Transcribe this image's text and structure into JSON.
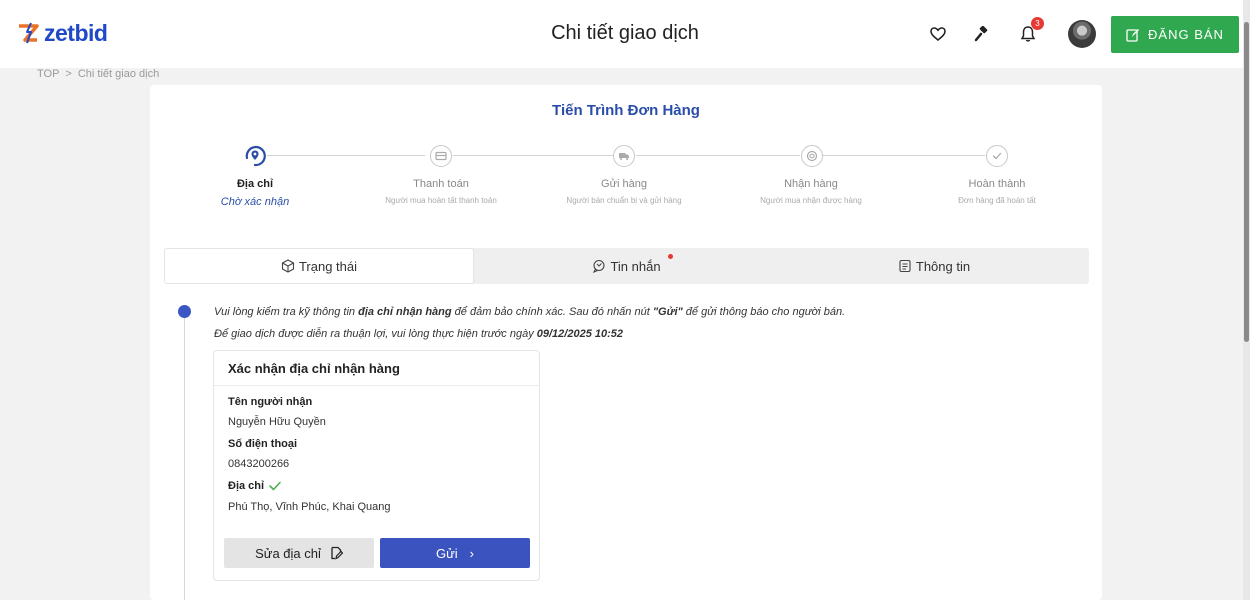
{
  "header": {
    "logo_text": "zetbid",
    "title": "Chi tiết giao dịch",
    "notification_count": "3",
    "post_button_label": "ĐĂNG BÁN"
  },
  "breadcrumb": {
    "home": "TOP",
    "separator": ">",
    "current": "Chi tiết giao dịch"
  },
  "progress": {
    "title": "Tiến Trình Đơn Hàng",
    "steps": [
      {
        "label": "Địa chỉ",
        "sub": "Chờ xác nhận",
        "icon": "location-icon",
        "active": true
      },
      {
        "label": "Thanh toán",
        "sub": "Người mua hoàn tất thanh toán",
        "icon": "card-icon",
        "active": false
      },
      {
        "label": "Gửi hàng",
        "sub": "Người bán chuẩn bị và gửi hàng",
        "icon": "truck-icon",
        "active": false
      },
      {
        "label": "Nhận hàng",
        "sub": "Người mua nhận được hàng",
        "icon": "box-icon",
        "active": false
      },
      {
        "label": "Hoàn thành",
        "sub": "Đơn hàng đã hoàn tất",
        "icon": "check-icon",
        "active": false
      }
    ]
  },
  "tabs": [
    {
      "label": "Trạng thái",
      "icon": "package-icon",
      "active": true
    },
    {
      "label": "Tin nhắn",
      "icon": "chat-icon",
      "active": false,
      "has_dot": true
    },
    {
      "label": "Thông tin",
      "icon": "document-icon",
      "active": false
    }
  ],
  "status": {
    "note1_pre": "Vui lòng kiểm tra kỹ thông tin ",
    "note1_bold": "địa chỉ nhận hàng",
    "note1_mid": " để đảm bảo chính xác. Sau đó nhấn nút ",
    "note1_bold2": "\"Gửi\"",
    "note1_post": " để gửi thông báo cho người bán.",
    "note2_pre": "Để giao dịch được diễn ra thuận lợi, vui lòng thực hiện trước ngày ",
    "note2_deadline": "09/12/2025 10:52"
  },
  "address_card": {
    "title": "Xác nhận địa chỉ nhận hàng",
    "recipient_label": "Tên người nhận",
    "recipient_value": "Nguyễn Hữu Quyền",
    "phone_label": "Số điện thoại",
    "phone_value": "0843200266",
    "address_label": "Địa chỉ",
    "address_value": "Phú Thọ, Vĩnh Phúc, Khai Quang",
    "edit_button": "Sửa địa chỉ",
    "send_button": "Gửi",
    "send_arrow": "›"
  },
  "colors": {
    "brand_blue": "#1f49c6",
    "accent_blue": "#3b53bf",
    "green": "#2fa84f",
    "badge_red": "#e53935"
  }
}
